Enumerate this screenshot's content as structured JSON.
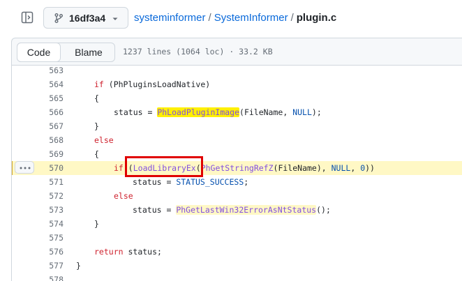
{
  "header": {
    "branch": "16df3a4",
    "breadcrumb": {
      "owner": "systeminformer",
      "repo": "SystemInformer",
      "separator": "/",
      "file": "plugin.c"
    }
  },
  "toolbar": {
    "code_label": "Code",
    "blame_label": "Blame",
    "file_info": "1237 lines (1064 loc) · 33.2 KB"
  },
  "code": {
    "highlighted_line": "570",
    "lines": [
      {
        "num": "563",
        "text": ""
      },
      {
        "num": "564",
        "text": "if (PhPluginsLoadNative)"
      },
      {
        "num": "565",
        "text": "{"
      },
      {
        "num": "566",
        "text": "status = PhLoadPluginImage(FileName, NULL);"
      },
      {
        "num": "567",
        "text": "}"
      },
      {
        "num": "568",
        "text": "else"
      },
      {
        "num": "569",
        "text": "{"
      },
      {
        "num": "570",
        "text": "if (LoadLibraryEx(PhGetStringRefZ(FileName), NULL, 0))"
      },
      {
        "num": "571",
        "text": "status = STATUS_SUCCESS;"
      },
      {
        "num": "572",
        "text": "else"
      },
      {
        "num": "573",
        "text": "status = PhGetLastWin32ErrorAsNtStatus();"
      },
      {
        "num": "574",
        "text": "}"
      },
      {
        "num": "575",
        "text": ""
      },
      {
        "num": "576",
        "text": "return status;"
      },
      {
        "num": "577",
        "text": "}"
      },
      {
        "num": "578",
        "text": ""
      }
    ]
  },
  "colors": {
    "link": "#0969da",
    "keyword": "#cf222e",
    "function": "#8250df",
    "constant": "#0550ae",
    "line_highlight": "#fff8c5",
    "search_match": "#fff000",
    "annotation_box": "#e00000"
  },
  "icons": [
    "side-panel-icon",
    "git-branch-icon",
    "caret-down-icon",
    "kebab-horizontal-icon"
  ]
}
